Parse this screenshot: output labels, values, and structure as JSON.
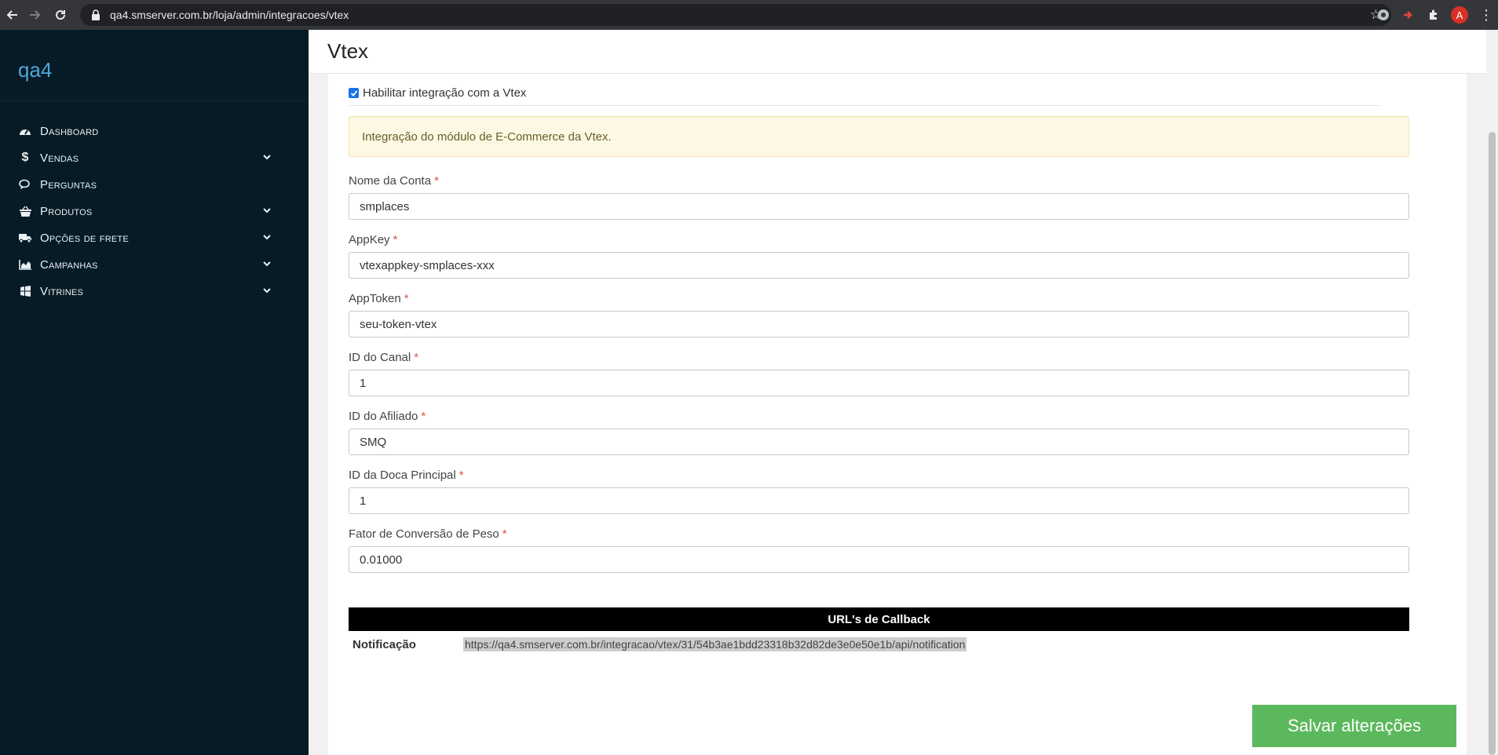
{
  "browser": {
    "url": "qa4.smserver.com.br/loja/admin/integracoes/vtex",
    "avatar_letter": "A"
  },
  "sidebar": {
    "brand": "qa4",
    "items": [
      {
        "label": "Dashboard",
        "icon": "dashboard-icon",
        "has_submenu": false
      },
      {
        "label": "Vendas",
        "icon": "dollar-icon",
        "has_submenu": true
      },
      {
        "label": "Perguntas",
        "icon": "comments-icon",
        "has_submenu": false
      },
      {
        "label": "Produtos",
        "icon": "basket-icon",
        "has_submenu": true
      },
      {
        "label": "Opções de frete",
        "icon": "truck-icon",
        "has_submenu": true
      },
      {
        "label": "Campanhas",
        "icon": "area-chart-icon",
        "has_submenu": true
      },
      {
        "label": "Vitrines",
        "icon": "windows-icon",
        "has_submenu": true
      }
    ]
  },
  "page": {
    "title": "Vtex",
    "enable_label": "Habilitar integração com a Vtex",
    "enable_checked": true,
    "alert_text": "Integração do módulo de E-Commerce da Vtex.",
    "required_mark": "*",
    "fields": [
      {
        "label": "Nome da Conta",
        "value": "smplaces"
      },
      {
        "label": "AppKey",
        "value": "vtexappkey-smplaces-xxx"
      },
      {
        "label": "AppToken",
        "value": "seu-token-vtex"
      },
      {
        "label": "ID do Canal",
        "value": "1"
      },
      {
        "label": "ID do Afiliado",
        "value": "SMQ"
      },
      {
        "label": "ID da Doca Principal",
        "value": "1"
      },
      {
        "label": "Fator de Conversão de Peso",
        "value": "0.01000"
      }
    ],
    "callback": {
      "header": "URL's de Callback",
      "rows": [
        {
          "key": "Notificação",
          "url": "https://qa4.smserver.com.br/integracao/vtex/31/54b3ae1bdd23318b32d82de3e0e50e1b/api/notification"
        }
      ]
    },
    "save_label": "Salvar alterações"
  },
  "colors": {
    "sidebar_bg": "#061b25",
    "brand": "#4ea7d9",
    "save_button": "#5cb85c",
    "alert_bg": "#fcf8e3",
    "required": "#d9534f"
  }
}
